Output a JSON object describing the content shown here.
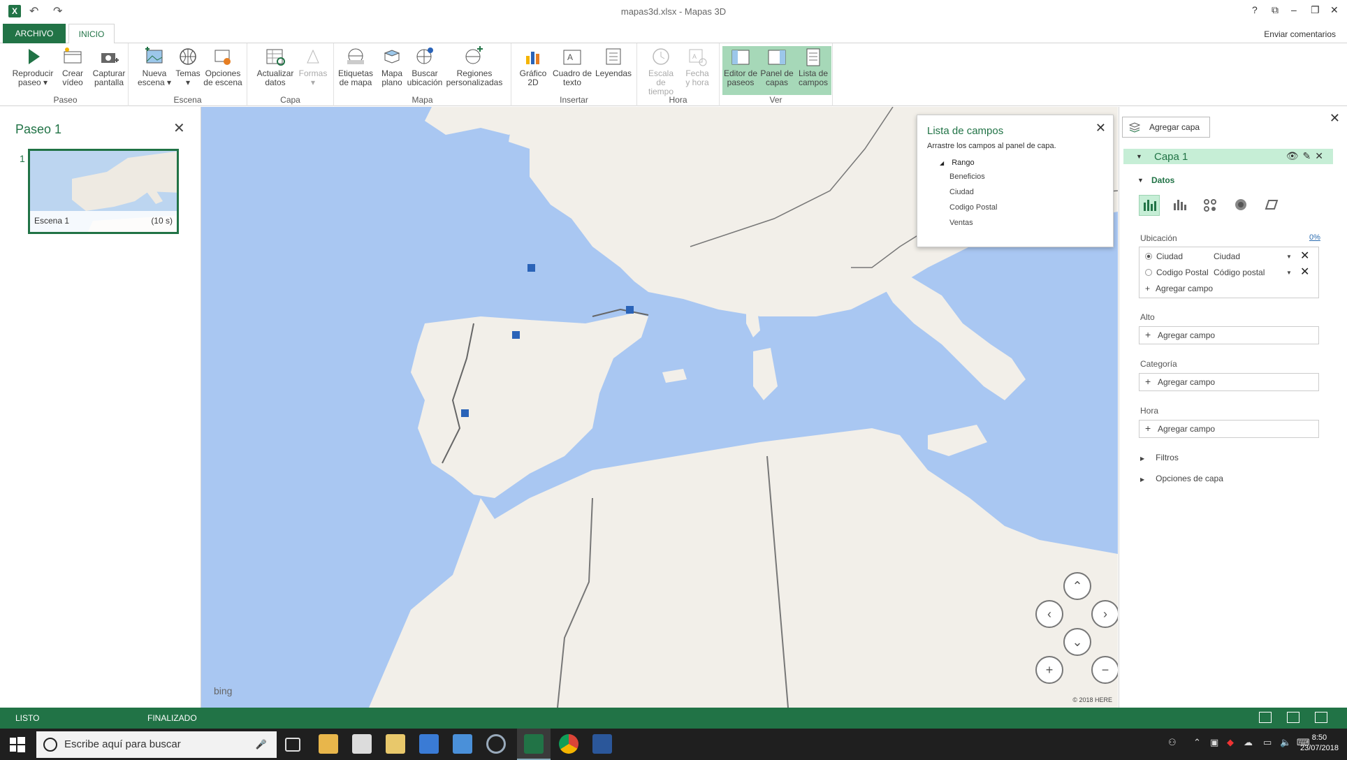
{
  "window": {
    "title": "mapas3d.xlsx - Mapas 3D",
    "controls": [
      "?",
      "⧉",
      "–",
      "❐",
      "✕"
    ]
  },
  "ribbon": {
    "tabs": {
      "file": "ARCHIVO",
      "home": "INICIO"
    },
    "feedback": "Enviar comentarios",
    "groups": [
      {
        "label": "Paseo",
        "buttons": [
          {
            "line1": "Reproducir",
            "line2": "paseo ▾",
            "icon": "play-icon"
          },
          {
            "line1": "Crear",
            "line2": "vídeo",
            "icon": "video-icon"
          },
          {
            "line1": "Capturar",
            "line2": "pantalla",
            "icon": "camera-icon"
          }
        ]
      },
      {
        "label": "Escena",
        "buttons": [
          {
            "line1": "Nueva",
            "line2": "escena ▾",
            "icon": "new-scene-icon"
          },
          {
            "line1": "Temas",
            "line2": "▾",
            "icon": "globe-icon"
          },
          {
            "line1": "Opciones",
            "line2": "de escena",
            "icon": "scene-options-icon"
          }
        ]
      },
      {
        "label": "Capa",
        "buttons": [
          {
            "line1": "Actualizar",
            "line2": "datos",
            "icon": "refresh-data-icon"
          },
          {
            "line1": "Formas",
            "line2": "▾",
            "icon": "shapes-icon",
            "disabled": true
          }
        ]
      },
      {
        "label": "Mapa",
        "buttons": [
          {
            "line1": "Etiquetas",
            "line2": "de mapa",
            "icon": "map-labels-icon"
          },
          {
            "line1": "Mapa",
            "line2": "plano",
            "icon": "flat-map-icon"
          },
          {
            "line1": "Buscar",
            "line2": "ubicación",
            "icon": "find-location-icon"
          },
          {
            "line1": "Regiones",
            "line2": "personalizadas",
            "icon": "custom-regions-icon"
          }
        ]
      },
      {
        "label": "Insertar",
        "buttons": [
          {
            "line1": "Gráfico",
            "line2": "2D",
            "icon": "chart-2d-icon"
          },
          {
            "line1": "Cuadro de",
            "line2": "texto",
            "icon": "text-box-icon"
          },
          {
            "line1": "Leyendas",
            "line2": "",
            "icon": "legend-icon"
          }
        ]
      },
      {
        "label": "Hora",
        "buttons": [
          {
            "line1": "Escala de",
            "line2": "tiempo",
            "icon": "clock-icon",
            "disabled": true
          },
          {
            "line1": "Fecha",
            "line2": "y hora",
            "icon": "date-time-icon",
            "disabled": true
          }
        ]
      },
      {
        "label": "Ver",
        "buttons": [
          {
            "line1": "Editor de",
            "line2": "paseos",
            "icon": "tour-editor-icon",
            "active": true
          },
          {
            "line1": "Panel de",
            "line2": "capas",
            "icon": "layer-pane-icon",
            "active": true
          },
          {
            "line1": "Lista de",
            "line2": "campos",
            "icon": "field-list-icon",
            "active": true
          }
        ]
      }
    ]
  },
  "tour": {
    "title": "Paseo 1",
    "scene_number": "1",
    "scene_name": "Escena 1",
    "scene_duration": "(10 s)"
  },
  "field_list": {
    "title": "Lista de campos",
    "subtitle": "Arrastre los campos al panel de capa.",
    "group": "Rango",
    "fields": [
      "Beneficios",
      "Ciudad",
      "Codigo Postal",
      "Ventas"
    ]
  },
  "map": {
    "attribution": "bing",
    "copyright": "© 2018 HERE",
    "nav": {
      "up": "⌃",
      "down": "⌄",
      "left": "‹",
      "right": "›",
      "zoom_in": "+",
      "zoom_out": "−"
    }
  },
  "layer_pane": {
    "add_layer": "Agregar capa",
    "layer_name": "Capa 1",
    "data_label": "Datos",
    "location_label": "Ubicación",
    "location_pct": "0%",
    "location_rows": [
      {
        "field": "Ciudad",
        "type": "Ciudad",
        "selected": true
      },
      {
        "field": "Codigo Postal",
        "type": "Código postal",
        "selected": false
      }
    ],
    "add_field": "Agregar campo",
    "height_label": "Alto",
    "category_label": "Categoría",
    "time_label": "Hora",
    "filters": "Filtros",
    "layer_options": "Opciones de capa"
  },
  "status": {
    "left": "LISTO",
    "mid": "FINALIZADO"
  },
  "taskbar": {
    "search_placeholder": "Escribe aquí para buscar",
    "time": "8:50",
    "date": "23/07/2018"
  },
  "colors": {
    "accent": "#217346",
    "map_water": "#a9c7f2",
    "map_land": "#f2efe9",
    "marker": "#2a63b8"
  }
}
